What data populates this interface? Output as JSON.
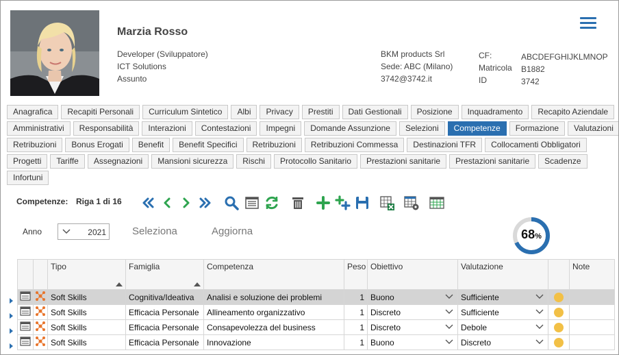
{
  "employee": {
    "name": "Marzia Rosso",
    "role": "Developer (Sviluppatore)",
    "department": "ICT Solutions",
    "status": "Assunto",
    "company": "BKM products Srl",
    "site": "Sede: ABC (Milano)",
    "email": "3742@3742.it",
    "cf_label": "CF:",
    "cf_value": "ABCDEFGHIJKLMNOP",
    "matricola_label": "Matricola",
    "matricola_value": "B1882",
    "id_label": "ID",
    "id_value": "3742"
  },
  "tabs": {
    "row1": [
      "Anagrafica",
      "Recapiti Personali",
      "Curriculum Sintetico",
      "Albi",
      "Privacy",
      "Prestiti",
      "Dati Gestionali",
      "Posizione",
      "Inquadramento",
      "Recapito Aziendale"
    ],
    "row2": [
      "Amministrativi",
      "Responsabilità",
      "Interazioni",
      "Contestazioni",
      "Impegni",
      "Domande Assunzione",
      "Selezioni",
      "Competenze",
      "Formazione",
      "Valutazioni"
    ],
    "row3": [
      "Retribuzioni",
      "Bonus Erogati",
      "Benefit",
      "Benefit Specifici",
      "Retribuzioni",
      "Retribuzioni Commessa",
      "Destinazioni TFR",
      "Collocamenti Obbligatori"
    ],
    "row4": [
      "Progetti",
      "Tariffe",
      "Assegnazioni",
      "Mansioni sicurezza",
      "Rischi",
      "Protocollo Sanitario",
      "Prestazioni sanitarie",
      "Prestazioni sanitarie",
      "Scadenze"
    ],
    "row5": [
      "Infortuni"
    ],
    "active": "Competenze"
  },
  "toolbar": {
    "label": "Competenze:",
    "record_info": "Riga 1 di 16"
  },
  "filter": {
    "anno_label": "Anno",
    "anno_value": "2021",
    "seleziona": "Seleziona",
    "aggiorna": "Aggiorna"
  },
  "progress": {
    "percent": 68,
    "percent_text": "68",
    "unit": "%"
  },
  "grid": {
    "columns": {
      "tipo": "Tipo",
      "famiglia": "Famiglia",
      "competenza": "Competenza",
      "peso": "Peso",
      "obiettivo": "Obiettivo",
      "valutazione": "Valutazione",
      "note": "Note"
    },
    "rows": [
      {
        "tipo": "Soft Skills",
        "famiglia": "Cognitiva/Ideativa",
        "competenza": "Analisi e soluzione dei problemi",
        "peso": "1",
        "obiettivo": "Buono",
        "valutazione": "Sufficiente"
      },
      {
        "tipo": "Soft Skills",
        "famiglia": "Efficacia Personale",
        "competenza": "Allineamento organizzativo",
        "peso": "1",
        "obiettivo": "Discreto",
        "valutazione": "Sufficiente"
      },
      {
        "tipo": "Soft Skills",
        "famiglia": "Efficacia Personale",
        "competenza": "Consapevolezza del business",
        "peso": "1",
        "obiettivo": "Discreto",
        "valutazione": "Debole"
      },
      {
        "tipo": "Soft Skills",
        "famiglia": "Efficacia Personale",
        "competenza": "Innovazione",
        "peso": "1",
        "obiettivo": "Buono",
        "valutazione": "Discreto"
      }
    ]
  },
  "colors": {
    "accent": "#2a6fb0",
    "green": "#2ea44f",
    "dot": "#f2c046",
    "donut_track": "#d9d9d9"
  }
}
